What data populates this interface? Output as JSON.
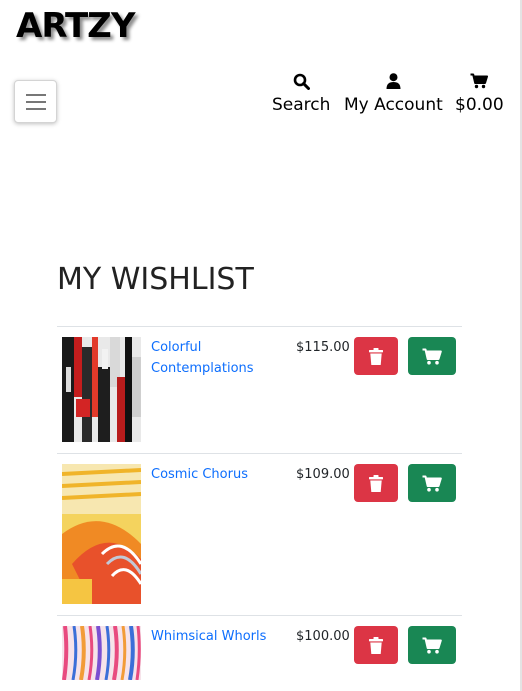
{
  "brand": {
    "name": "ARTZY"
  },
  "nav": {
    "search_label": "Search",
    "account_label": "My Account",
    "cart_total": "$0.00"
  },
  "page_title": "MY WISHLIST",
  "wishlist": [
    {
      "title": "Colorful Contemplations",
      "price": "$115.00"
    },
    {
      "title": "Cosmic Chorus",
      "price": "$109.00"
    },
    {
      "title": "Whimsical Whorls",
      "price": "$100.00"
    }
  ],
  "colors": {
    "delete_button": "#dc3545",
    "cart_button": "#198754",
    "link": "#0d6efd"
  },
  "icons": {
    "search": "search-icon",
    "account": "user-icon",
    "cart": "cart-icon",
    "delete": "trash-icon",
    "menu": "hamburger-icon"
  }
}
